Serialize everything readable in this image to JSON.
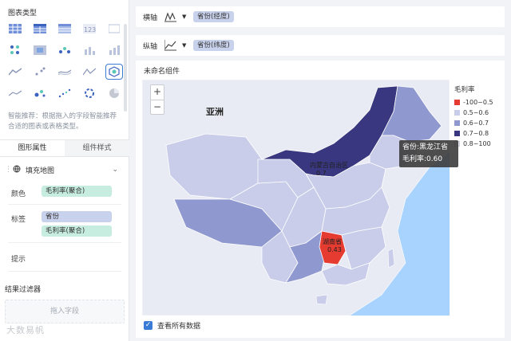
{
  "left_panel": {
    "chart_type_title": "图表类型",
    "hint": "智能推荐：根据拖入的字段智能推荐合适的图表或表格类型。",
    "chart_types": [
      "table-icon",
      "cross-table-icon",
      "detail-table-icon",
      "kpi-number-icon",
      "scroll-icon",
      "dot-matrix-icon",
      "heatmap-icon",
      "scatter-points-icon",
      "bar-chart-icon",
      "column-chart-icon",
      "area-chart-icon",
      "scatter-chart-icon",
      "multi-line-icon",
      "radar-icon",
      "map-icon",
      "line-chart-icon",
      "bubble-chart-icon",
      "dot-trend-icon",
      "ring-icon",
      "pie-icon"
    ],
    "tabs": [
      "图形属性",
      "组件样式"
    ],
    "map_type": "填充地图",
    "color_label": "颜色",
    "color_field": "毛利率(聚合)",
    "label_label": "标签",
    "label_fields": [
      "省份",
      "毛利率(聚合)"
    ],
    "tooltip_label": "提示",
    "result_filter_title": "结果过滤器",
    "drop_field": "拖入字段",
    "watermark": "大数易帆"
  },
  "axes": {
    "x_label": "横轴",
    "x_field": "省份(经度)",
    "y_label": "纵轴",
    "y_field": "省份(纬度)"
  },
  "component": {
    "title": "未命名组件",
    "map_text": {
      "continent": "亚洲",
      "region1": "内蒙古自治区",
      "region1_value": "0.7",
      "region2": "湖南省",
      "region2_value": "0.43"
    },
    "zoom_in": "+",
    "zoom_out": "−",
    "tooltip": {
      "line1": "省份:黑龙江省",
      "line2": "毛利率:0.60"
    },
    "legend": {
      "title": "毛利率",
      "items": [
        {
          "label": "-100~0.5",
          "color": "#e53b30"
        },
        {
          "label": "0.5~0.6",
          "color": "#c9cdea"
        },
        {
          "label": "0.6~0.7",
          "color": "#8f99cf"
        },
        {
          "label": "0.7~0.8",
          "color": "#39377f"
        },
        {
          "label": "0.8~100",
          "color": "#e9ebf4"
        }
      ]
    },
    "show_all_data": "查看所有数据"
  }
}
